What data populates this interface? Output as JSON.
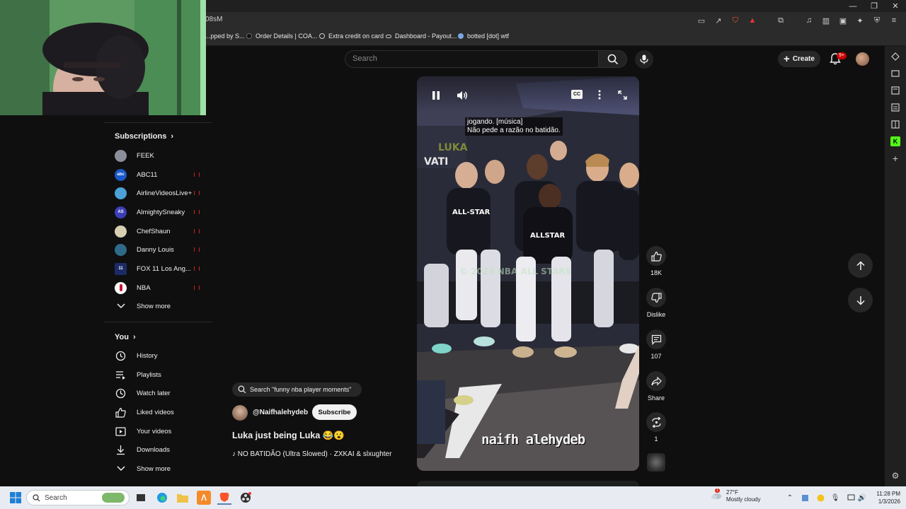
{
  "browser": {
    "address_fragment": "08sM",
    "bookmarks": [
      {
        "label": "...pped by S..."
      },
      {
        "label": "Order Details | COA..."
      },
      {
        "label": "Extra credit on card"
      },
      {
        "label": "Dashboard - Payout..."
      },
      {
        "label": "botted [dot] wtf"
      }
    ],
    "shield_badge": "2"
  },
  "header": {
    "search_placeholder": "Search",
    "create_label": "Create",
    "notifications_badge": "9+"
  },
  "sidebar": {
    "subscriptions_title": "Subscriptions",
    "subscriptions": [
      {
        "name": "FEEK",
        "live": false,
        "color": "#8a8f99",
        "initials": ""
      },
      {
        "name": "ABC11",
        "live": true,
        "color": "#1a58c9",
        "initials": "abc"
      },
      {
        "name": "AirlineVideosLive+",
        "live": true,
        "color": "#4aa2d6",
        "initials": ""
      },
      {
        "name": "AlmightySneaky",
        "live": true,
        "color": "#3b3fb6",
        "initials": "AS"
      },
      {
        "name": "ChefShaun",
        "live": true,
        "color": "#d8cfb2",
        "initials": ""
      },
      {
        "name": "Danny Louis",
        "live": true,
        "color": "#2f6a8a",
        "initials": ""
      },
      {
        "name": "FOX 11 Los Ang...",
        "live": true,
        "color": "#1b2b66",
        "initials": "11"
      },
      {
        "name": "NBA",
        "live": true,
        "color": "#ffffff",
        "initials": ""
      }
    ],
    "show_more_1": "Show more",
    "you_title": "You",
    "you_items": [
      {
        "name": "History",
        "icon": "history-icon"
      },
      {
        "name": "Playlists",
        "icon": "playlists-icon"
      },
      {
        "name": "Watch later",
        "icon": "watch-later-icon"
      },
      {
        "name": "Liked videos",
        "icon": "liked-videos-icon"
      },
      {
        "name": "Your videos",
        "icon": "your-videos-icon"
      },
      {
        "name": "Downloads",
        "icon": "downloads-icon"
      }
    ],
    "show_more_2": "Show more"
  },
  "short": {
    "related_search": "Search \"funny nba player moments\"",
    "channel": "@Naifhalehydeb",
    "subscribe_label": "Subscribe",
    "title": "Luka just being Luka 😂😮",
    "audio": "NO BATIDÃO (Ultra Slowed) · ZXKAI & slxughter",
    "captions_line1": "jogando. [música]",
    "captions_line2": "Não pede a razão no batidão.",
    "watermark": "naifh alehydeb",
    "cc_label": "CC"
  },
  "actions": {
    "likes": "18K",
    "dislike_label": "Dislike",
    "comments": "107",
    "share_label": "Share",
    "remix_count": "1"
  },
  "taskbar": {
    "search_placeholder": "Search",
    "weather_temp": "27°F",
    "weather_desc": "Mostly cloudy",
    "weather_alert": "1",
    "time": "11:28 PM",
    "date": "1/3/2026"
  }
}
